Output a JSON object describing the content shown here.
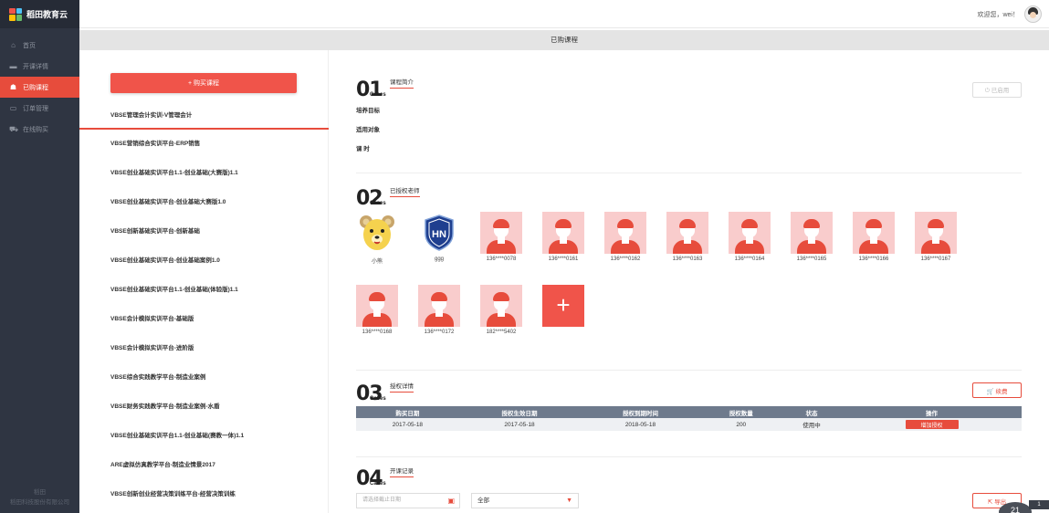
{
  "app": {
    "brand_name": "稻田教育云",
    "logo_colors": [
      "#f0544a",
      "#4fc3f7",
      "#ffc107",
      "#66bb6a"
    ]
  },
  "sidebar": {
    "items": [
      {
        "label": "首页",
        "icon": "home-icon",
        "glyph": "⌂"
      },
      {
        "label": "开课详情",
        "icon": "folder-icon",
        "glyph": "▬"
      },
      {
        "label": "已购课程",
        "icon": "cart-bag-icon",
        "glyph": "☗"
      },
      {
        "label": "订单管理",
        "icon": "card-icon",
        "glyph": "▭"
      },
      {
        "label": "在线购买",
        "icon": "shopping-cart-icon",
        "glyph": "⛟"
      }
    ],
    "footer_line1": "稻田",
    "footer_line2": "稻田科技股份有限公司"
  },
  "header": {
    "welcome": "欢迎您，wei！"
  },
  "page": {
    "title": "已购课程"
  },
  "left": {
    "buy_button": "+ 购买课程",
    "courses": [
      "VBSE管理会计实训-V管理会计",
      "VBSE营销综合实训平台-ERP销售",
      "VBSE创业基础实训平台1.1-创业基础(大赛版)1.1",
      "VBSE创业基础实训平台-创业基础大赛版1.0",
      "VBSE创新基础实训平台-创新基础",
      "VBSE创业基础实训平台-创业基础案例1.0",
      "VBSE创业基础实训平台1.1-创业基础(体验版)1.1",
      "VBSE会计模拟实训平台-基础版",
      "VBSE会计模拟实训平台-进阶版",
      "VBSE综合实践教学平台-制造业案例",
      "VBSE财务实践教学平台-制造业案例-水盾",
      "VBSE创业基础实训平台1.1-创业基础(赛教一体)1.1",
      "ARE虚拟仿真教学平台-制造业情景2017",
      "VBSE创新创业经营决策训练平台-经营决策训练"
    ]
  },
  "sections": {
    "intro": {
      "num": "01",
      "cases": "Cases",
      "title": "课程简介",
      "used_button": "已启用",
      "rows": [
        "培养目标",
        "适用对象",
        "课  时"
      ]
    },
    "teachers": {
      "num": "02",
      "cases": "Cases",
      "title": "已授权老师",
      "row1": [
        {
          "name": "小熊",
          "avatar": "bear-avatar"
        },
        {
          "name": "ggg",
          "avatar": "hn-shield-avatar"
        },
        {
          "name": "136****0078",
          "avatar": "default-avatar"
        },
        {
          "name": "136****0161",
          "avatar": "default-avatar"
        },
        {
          "name": "136****0162",
          "avatar": "default-avatar"
        },
        {
          "name": "136****0163",
          "avatar": "default-avatar"
        },
        {
          "name": "136****0164",
          "avatar": "default-avatar"
        },
        {
          "name": "136****0165",
          "avatar": "default-avatar"
        },
        {
          "name": "136****0166",
          "avatar": "default-avatar"
        },
        {
          "name": "136****0167",
          "avatar": "default-avatar"
        }
      ],
      "row2": [
        {
          "name": "136****0168",
          "avatar": "default-avatar"
        },
        {
          "name": "136****0172",
          "avatar": "default-avatar"
        },
        {
          "name": "182****5402",
          "avatar": "default-avatar"
        }
      ],
      "add_glyph": "+"
    },
    "auth": {
      "num": "03",
      "cases": "Cases",
      "title": "授权详情",
      "renew_button": "续费",
      "columns": [
        "购买日期",
        "授权生效日期",
        "授权到期时间",
        "授权数量",
        "状态",
        "操作"
      ],
      "row": {
        "purchase_date": "2017-05-18",
        "effective_date": "2017-05-18",
        "expiry_date": "2018-05-18",
        "quantity": "200",
        "status": "使用中",
        "action": "增加授权"
      }
    },
    "records": {
      "num": "04",
      "cases": "Cases",
      "title": "开课记录",
      "date_placeholder": "请选择截止日期",
      "select_value": "全部",
      "export_button": "导出"
    }
  },
  "overlay": {
    "badge": "21",
    "strip": "1"
  }
}
